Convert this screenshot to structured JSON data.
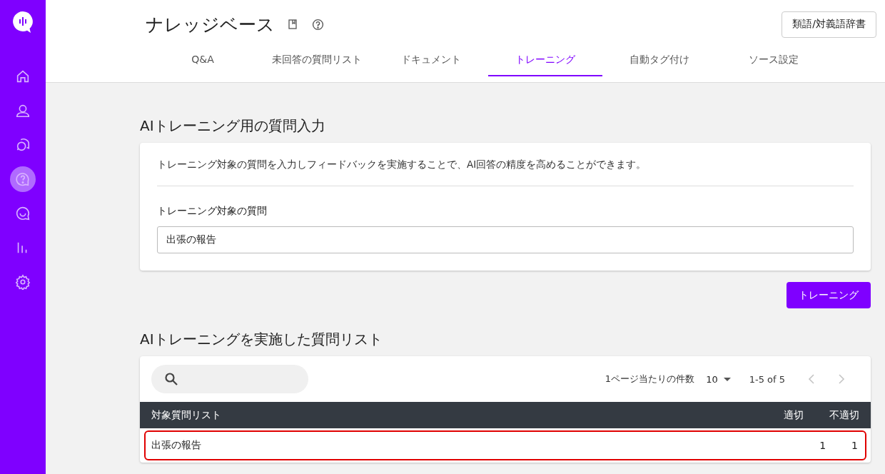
{
  "sidebar": {
    "items": [
      {
        "kind": "home",
        "selected": false
      },
      {
        "kind": "user",
        "selected": false
      },
      {
        "kind": "chat",
        "selected": false
      },
      {
        "kind": "help",
        "selected": true
      },
      {
        "kind": "smile",
        "selected": false
      },
      {
        "kind": "chart",
        "selected": false
      },
      {
        "kind": "settings",
        "selected": false
      }
    ]
  },
  "header": {
    "title": "ナレッジベース",
    "dictionary_button": "類語/対義語辞書"
  },
  "tabs": [
    {
      "label": "Q&A",
      "selected": false
    },
    {
      "label": "未回答の質問リスト",
      "selected": false
    },
    {
      "label": "ドキュメント",
      "selected": false
    },
    {
      "label": "トレーニング",
      "selected": true
    },
    {
      "label": "自動タグ付け",
      "selected": false
    },
    {
      "label": "ソース設定",
      "selected": false
    }
  ],
  "training_input": {
    "heading": "AIトレーニング用の質問入力",
    "description": "トレーニング対象の質問を入力しフィードバックを実施することで、AI回答の精度を高めることができます。",
    "field_label": "トレーニング対象の質問",
    "value": "出張の報告",
    "button": "トレーニング"
  },
  "question_list": {
    "heading": "AIトレーニングを実施した質問リスト",
    "rows_per_page_label": "1ページ当たりの件数",
    "rows_per_page": "10",
    "range": "1-5 of 5",
    "prev_disabled": true,
    "next_disabled": true,
    "columns": [
      "対象質問リスト",
      "適切",
      "不適切"
    ],
    "rows": [
      {
        "question": "出張の報告",
        "appropriate": "1",
        "inappropriate": "1",
        "highlighted": true
      }
    ]
  }
}
